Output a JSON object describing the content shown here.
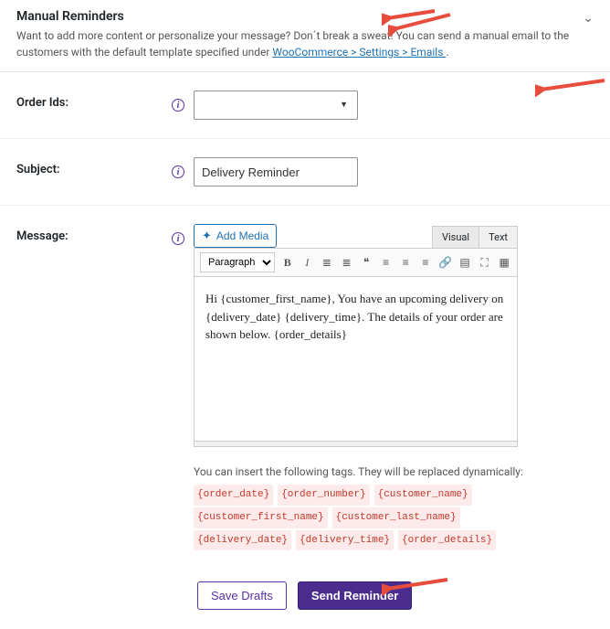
{
  "header": {
    "title": "Manual Reminders",
    "description_pre": "Want to add more content or personalize your message? Don´t break a sweat! You can send a manual email to the customers with the default template specified under ",
    "description_link": "WooCommerce > Settings > Emails ",
    "description_post": "."
  },
  "fields": {
    "order_ids": {
      "label": "Order Ids:",
      "value": ""
    },
    "subject": {
      "label": "Subject:",
      "value": "Delivery Reminder"
    },
    "message": {
      "label": "Message:"
    }
  },
  "editor": {
    "add_media": "Add Media",
    "tab_visual": "Visual",
    "tab_text": "Text",
    "format_option": "Paragraph",
    "content": "Hi {customer_first_name}, You have an upcoming delivery on {delivery_date} {delivery_time}. The details of your order are shown below. {order_details}"
  },
  "tags_note_pre": "You can insert the following tags. They will be replaced dynamically: ",
  "tags": [
    "{order_date}",
    "{order_number}",
    "{customer_name}",
    "{customer_first_name}",
    "{customer_last_name}",
    "{delivery_date}",
    "{delivery_time}",
    "{order_details}"
  ],
  "buttons": {
    "save_drafts": "Save Drafts",
    "send_reminder": "Send Reminder"
  },
  "toolbar_icons": {
    "bold": "B",
    "italic": "I",
    "bullets": "≣",
    "numbers": "≣",
    "quote": "❝",
    "align_l": "≡",
    "align_c": "≡",
    "align_r": "≡",
    "link": "🔗",
    "more": "▤",
    "full": "⛶",
    "kitchen": "▦"
  }
}
